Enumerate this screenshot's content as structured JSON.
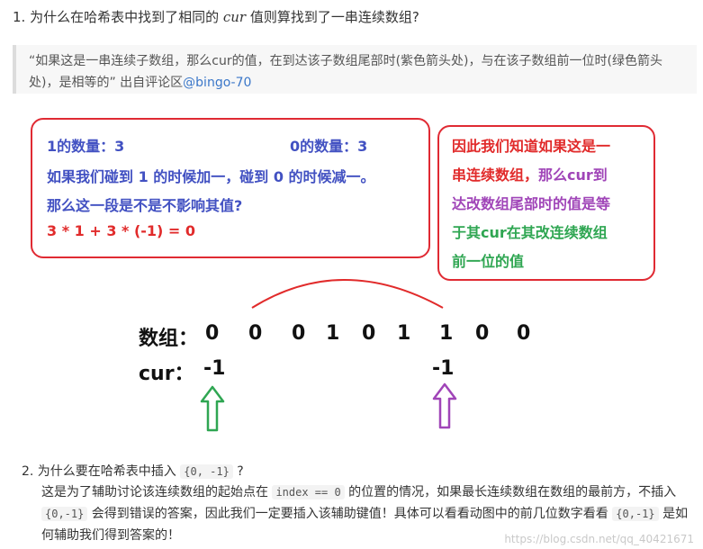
{
  "q1": {
    "prefix": "1. 为什么在哈希表中找到了相同的 ",
    "var": "cur",
    "suffix": " 值则算找到了一串连续数组?"
  },
  "quote": {
    "text": "“如果这是一串连续子数组，那么cur的值，在到达该子数组尾部时(紫色箭头处)，与在该子数组前一位时(绿色箭头处)，是相等的” 出自评论区",
    "user": "@bingo-70"
  },
  "box1": {
    "count1": "1的数量：3",
    "count0": "0的数量：3",
    "line2": "如果我们碰到 1 的时候加一，碰到 0 的时候减一。",
    "line3": "那么这一段是不是不影响其值?",
    "formula": "3 * 1 + 3 * (-1) = 0"
  },
  "box2": {
    "l1": "因此我们知道如果这是一",
    "l2a": "串连续数组，",
    "l2b": "那么cur到",
    "l3": "达改数组尾部时的值是等",
    "l4": "于其cur在其改连续数组",
    "l5": "前一位的值"
  },
  "array": {
    "label": "数组：",
    "values": [
      "0",
      "0",
      "0",
      "1",
      "0",
      "1",
      "1",
      "0",
      "0"
    ]
  },
  "cur": {
    "label": "cur：",
    "left": "-1",
    "right": "-1"
  },
  "colors": {
    "red": "#e12b2b",
    "blue": "#4251c2",
    "purple": "#a045b8",
    "green": "#2fa652"
  },
  "q2": {
    "title_prefix": "2. 为什么要在哈希表中插入 ",
    "title_code": "{0, -1}",
    "title_suffix": " ?",
    "b1": "这是为了辅助讨论该连续数组的起始点在 ",
    "c1": "index == 0",
    "b2": " 的位置的情况，如果最长连续数组在数组的最前方，不插入 ",
    "c2": "{0,-1}",
    "b3": " 会得到错误的答案，因此我们一定要插入该辅助键值！具体可以看看动图中的前几位数字看看 ",
    "c3": "{0,-1}",
    "b4": " 是如何辅助我们得到答案的！"
  },
  "watermark": "https://blog.csdn.net/qq_40421671"
}
